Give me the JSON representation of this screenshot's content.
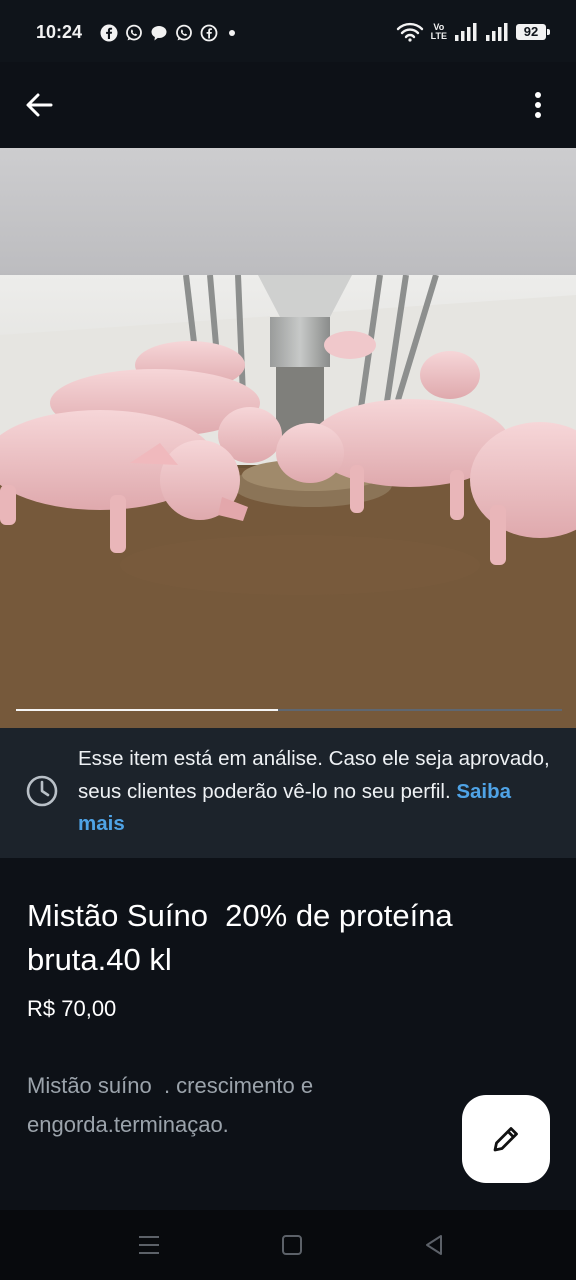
{
  "status_bar": {
    "time": "10:24",
    "notification_icons": [
      "facebook-icon",
      "whatsapp-icon",
      "chat-bubble-icon",
      "whatsapp-icon",
      "facebook-messenger-icon"
    ],
    "network_label_top": "Vo",
    "network_label_bottom": "LTE",
    "battery": "92"
  },
  "app_bar": {
    "back_icon": "arrow-left-icon",
    "menu_icon": "more-vert-icon"
  },
  "media": {
    "photo_subject": "pigs-eating-at-feeder",
    "progress": 0.48
  },
  "review_banner": {
    "icon": "clock-icon",
    "message": "Esse item está em análise. Caso ele seja aprovado, seus clientes poderão vê-lo no seu perfil.",
    "link": "Saiba mais",
    "link_color": "#4fa3e6"
  },
  "listing": {
    "title": "Mistão Suíno  20% de proteína bruta.40 kl",
    "price": "R$ 70,00",
    "description": "Mistão suíno  . crescimento e engorda.terminaçao."
  },
  "fab": {
    "icon": "pencil-icon"
  },
  "navigation": {
    "recents_icon": "menu-lines-icon",
    "home_icon": "square-icon",
    "back_icon": "triangle-back-icon"
  }
}
